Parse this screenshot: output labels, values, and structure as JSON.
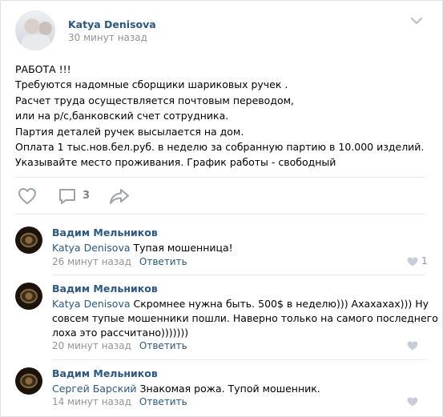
{
  "post": {
    "author": "Katya Denisova",
    "time": "30 минут назад",
    "lines": [
      "РАБОТА !!!",
      "Требуются надомные сборщики шариковых ручек .",
      "Расчет труда осуществляется почтовым переводом,",
      "или на р/с,банковский счет сотрудника.",
      "Партия деталей ручек высылается на дом.",
      "Оплата 1 тыс.нов.бел.руб. в неделю за собранную партию в 10.000 изделий.",
      "Указывайте место проживания. График работы - свободный"
    ],
    "comments_count": "3",
    "icons": {
      "menu": "chevron-down-icon",
      "like": "heart-icon",
      "comment": "comment-icon",
      "share": "share-icon"
    }
  },
  "comments": [
    {
      "author": "Вадим Мельников",
      "reply_to": "Katya Denisova",
      "text_lines": [
        "Тупая мошенница!"
      ],
      "time": "26 минут назад",
      "answer": "Ответить",
      "likes": "1"
    },
    {
      "author": "Вадим Мельников",
      "reply_to": "Katya Denisova",
      "text_lines": [
        "Скромнее нужна быть. 500$ в неделю))) Ахахахах))) Ну",
        "совсем тупые мошенники пошли. Наверно только на самого последнего",
        "лоха это рассчитано)))))))"
      ],
      "time": "20 минут назад",
      "answer": "Ответить",
      "likes": ""
    },
    {
      "author": "Вадим Мельников",
      "reply_to": "Сергей Барский",
      "text_lines": [
        "Знакомая рожа. Тупой мошенник."
      ],
      "time": "14 минут назад",
      "answer": "Ответить",
      "likes": ""
    }
  ],
  "colors": {
    "link": "#2a5885",
    "muted": "#939393",
    "icon": "#99a2ad",
    "divider": "#e7e8ec"
  }
}
